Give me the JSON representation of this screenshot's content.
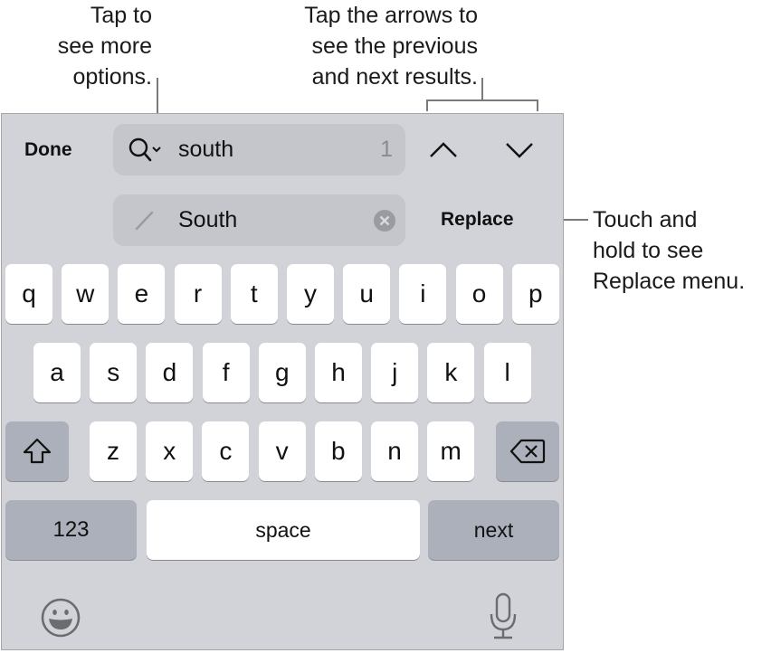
{
  "callouts": {
    "options": "Tap to\nsee more\noptions.",
    "arrows": "Tap the arrows to\nsee the previous\nand next results.",
    "replace": "Touch and\nhold to see\nReplace menu."
  },
  "toolbar": {
    "done_label": "Done",
    "search_value": "south",
    "match_count": "1",
    "replace_value": "South",
    "replace_label": "Replace",
    "icons": {
      "search": "magnifier-with-chevron",
      "previous": "chevron-up",
      "next": "chevron-down",
      "pencil": "pencil",
      "clear": "x-circle"
    }
  },
  "keyboard": {
    "row1": [
      "q",
      "w",
      "e",
      "r",
      "t",
      "y",
      "u",
      "i",
      "o",
      "p"
    ],
    "row2": [
      "a",
      "s",
      "d",
      "f",
      "g",
      "h",
      "j",
      "k",
      "l"
    ],
    "row3": [
      "z",
      "x",
      "c",
      "v",
      "b",
      "n",
      "m"
    ],
    "shift_icon": "shift-arrow",
    "delete_icon": "backspace",
    "numbers_label": "123",
    "space_label": "space",
    "next_label": "next",
    "emoji_icon": "emoji-smiley",
    "mic_icon": "microphone"
  },
  "colors": {
    "keyboard_bg": "#d1d3d9",
    "field_bg": "#c4c6cc",
    "key_bg": "#ffffff",
    "special_key_bg": "#abb0ba"
  }
}
